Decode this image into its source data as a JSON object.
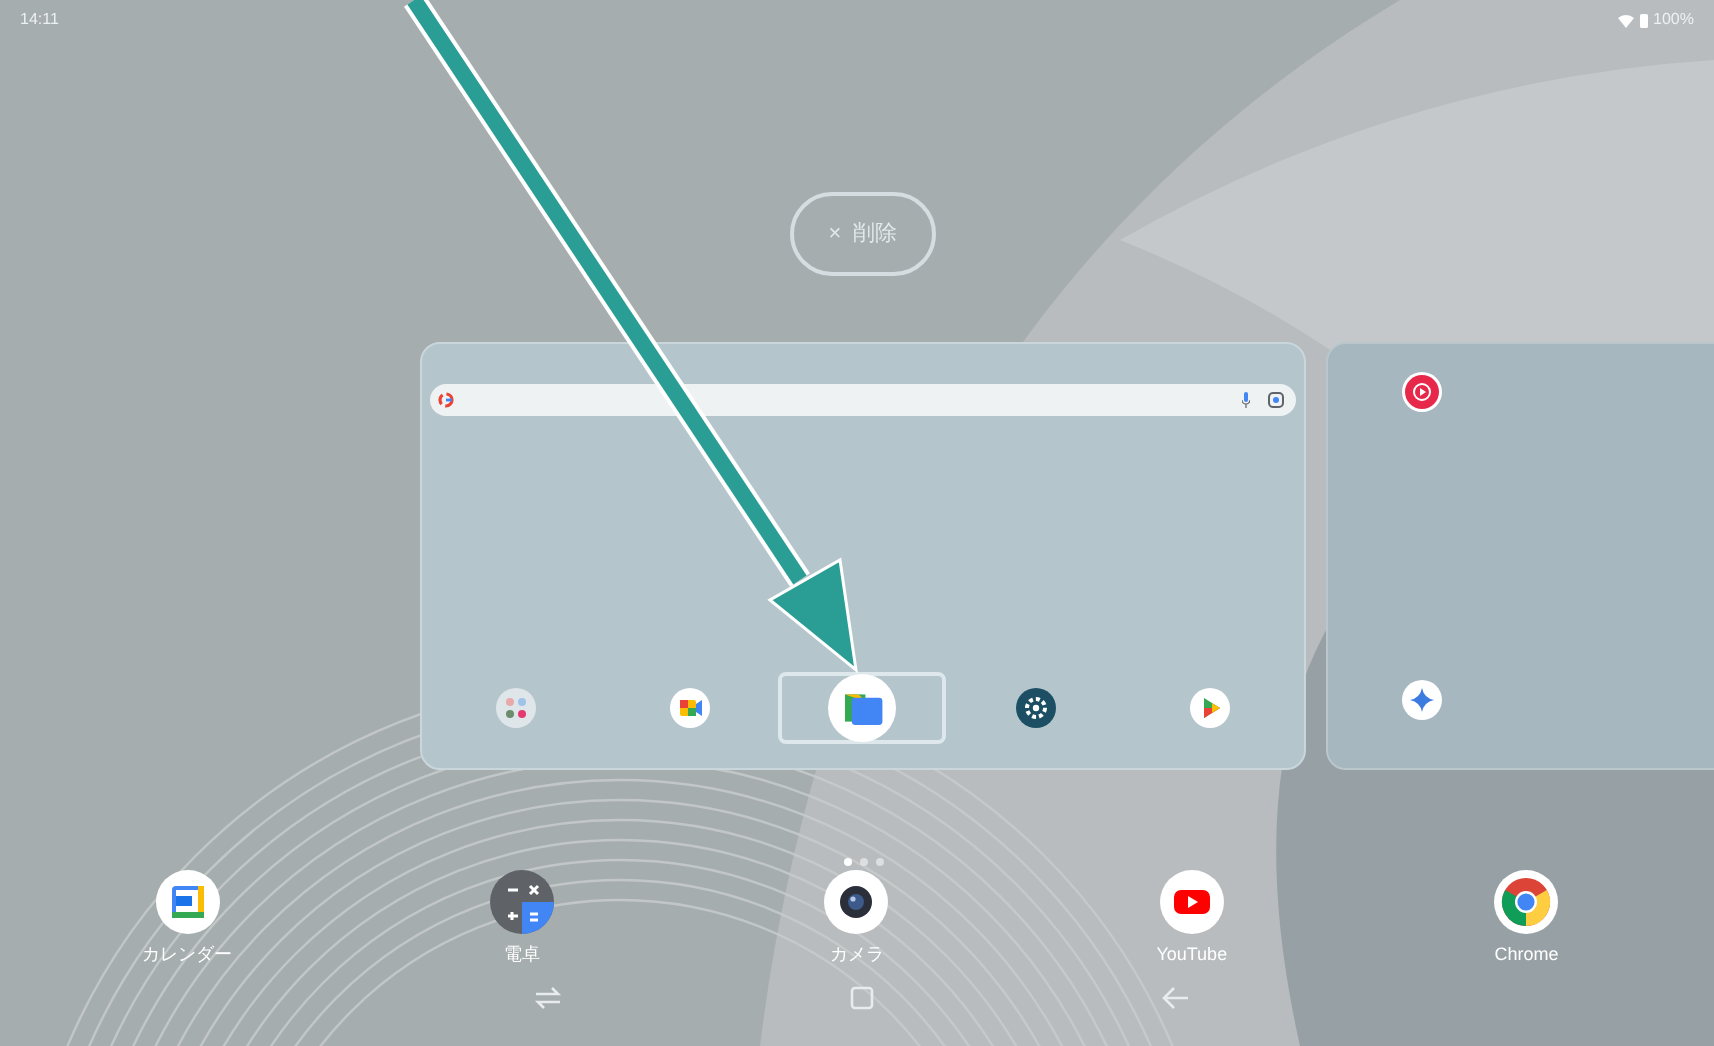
{
  "status_bar": {
    "time": "14:11",
    "battery": "100%"
  },
  "delete_button": {
    "icon": "×",
    "label": "削除"
  },
  "recent_cards": [
    {
      "apps": [
        {
          "kind": "folder",
          "selected": false
        },
        {
          "kind": "meet",
          "selected": false
        },
        {
          "kind": "files",
          "selected": true
        },
        {
          "kind": "settings",
          "selected": false
        },
        {
          "kind": "play",
          "selected": false
        }
      ]
    },
    {
      "apps": [
        {
          "kind": "music"
        },
        {
          "kind": "gemini"
        }
      ]
    }
  ],
  "page_indicator": [
    {
      "selected": true
    },
    {
      "selected": false
    },
    {
      "selected": false
    }
  ],
  "dock": [
    {
      "kind": "calendar",
      "label": "カレンダー"
    },
    {
      "kind": "calculator",
      "label": "電卓"
    },
    {
      "kind": "camera",
      "label": "カメラ"
    },
    {
      "kind": "youtube",
      "label": "YouTube"
    },
    {
      "kind": "chrome",
      "label": "Chrome"
    }
  ]
}
